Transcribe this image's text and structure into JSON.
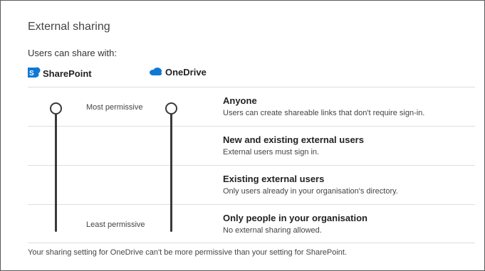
{
  "panel": {
    "title": "External sharing",
    "subtitle": "Users can share with:"
  },
  "services": {
    "sharepoint": {
      "label": "SharePoint",
      "icon": "sharepoint-icon",
      "color": "#0f78d4"
    },
    "onedrive": {
      "label": "OneDrive",
      "icon": "onedrive-cloud-icon",
      "color": "#0f78d4"
    }
  },
  "slider_labels": {
    "most": "Most permissive",
    "least": "Least permissive"
  },
  "sliders": {
    "sharepoint_selected_level": "Anyone",
    "onedrive_selected_level": "Anyone"
  },
  "options": [
    {
      "title": "Anyone",
      "desc": "Users can create shareable links that don't require sign-in."
    },
    {
      "title": "New and existing external users",
      "desc": "External users must sign in."
    },
    {
      "title": "Existing external users",
      "desc": "Only users already in your organisation's directory."
    },
    {
      "title": "Only people in your organisation",
      "desc": "No external sharing allowed."
    }
  ],
  "footnote": "Your sharing setting for OneDrive can't be more permissive than your setting for SharePoint."
}
